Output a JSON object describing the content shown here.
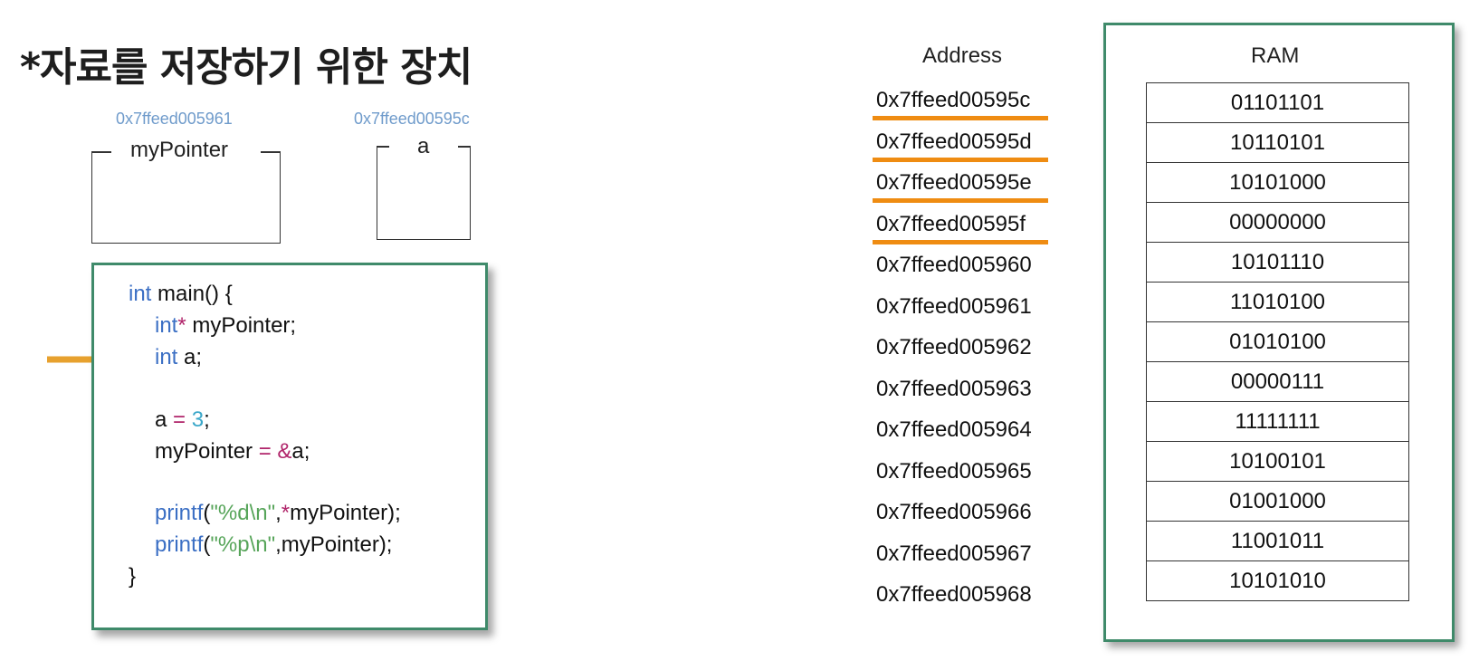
{
  "title": "*자료를 저장하기 위한 장치",
  "variables": [
    {
      "name": "myPointer",
      "address": "0x7ffeed005961"
    },
    {
      "name": "a",
      "address": "0x7ffeed00595c"
    }
  ],
  "code": {
    "line1": {
      "kw": "int",
      "rest": " main() {"
    },
    "line2": {
      "kw": "int",
      "op": "*",
      "rest": " myPointer;"
    },
    "line3": {
      "kw": "int",
      "rest": " a;"
    },
    "line4": {
      "a": "a ",
      "op": "=",
      "sp": " ",
      "num": "3",
      "end": ";"
    },
    "line5": {
      "a": "myPointer ",
      "op": "=",
      "sp": " ",
      "amp": "&",
      "end": "a;"
    },
    "line6": {
      "fn": "printf",
      "p1": "(",
      "str": "\"%d\\n\"",
      "comma": ",",
      "star": "*",
      "end": "myPointer);"
    },
    "line7": {
      "fn": "printf",
      "p1": "(",
      "str": "\"%p\\n\"",
      "end": ",myPointer);"
    },
    "line8": "}"
  },
  "memory": {
    "address_header": "Address",
    "ram_header": "RAM",
    "addresses": [
      "0x7ffeed00595c",
      "0x7ffeed00595d",
      "0x7ffeed00595e",
      "0x7ffeed00595f",
      "0x7ffeed005960",
      "0x7ffeed005961",
      "0x7ffeed005962",
      "0x7ffeed005963",
      "0x7ffeed005964",
      "0x7ffeed005965",
      "0x7ffeed005966",
      "0x7ffeed005967",
      "0x7ffeed005968"
    ],
    "values": [
      "01101101",
      "10110101",
      "10101000",
      "00000000",
      "10101110",
      "11010100",
      "01010100",
      "00000111",
      "11111111",
      "10100101",
      "01001000",
      "11001011",
      "10101010"
    ],
    "highlighted_addresses": [
      "0x7ffeed00595c",
      "0x7ffeed00595d",
      "0x7ffeed00595e",
      "0x7ffeed00595f"
    ]
  },
  "colors": {
    "highlight": "#ef8c12",
    "frame": "#3f8a6a",
    "keyword": "#3b6fc4",
    "operator": "#b0246a",
    "string": "#57a55a",
    "number": "#3aa7c9",
    "small_address": "#6f9bcb"
  }
}
